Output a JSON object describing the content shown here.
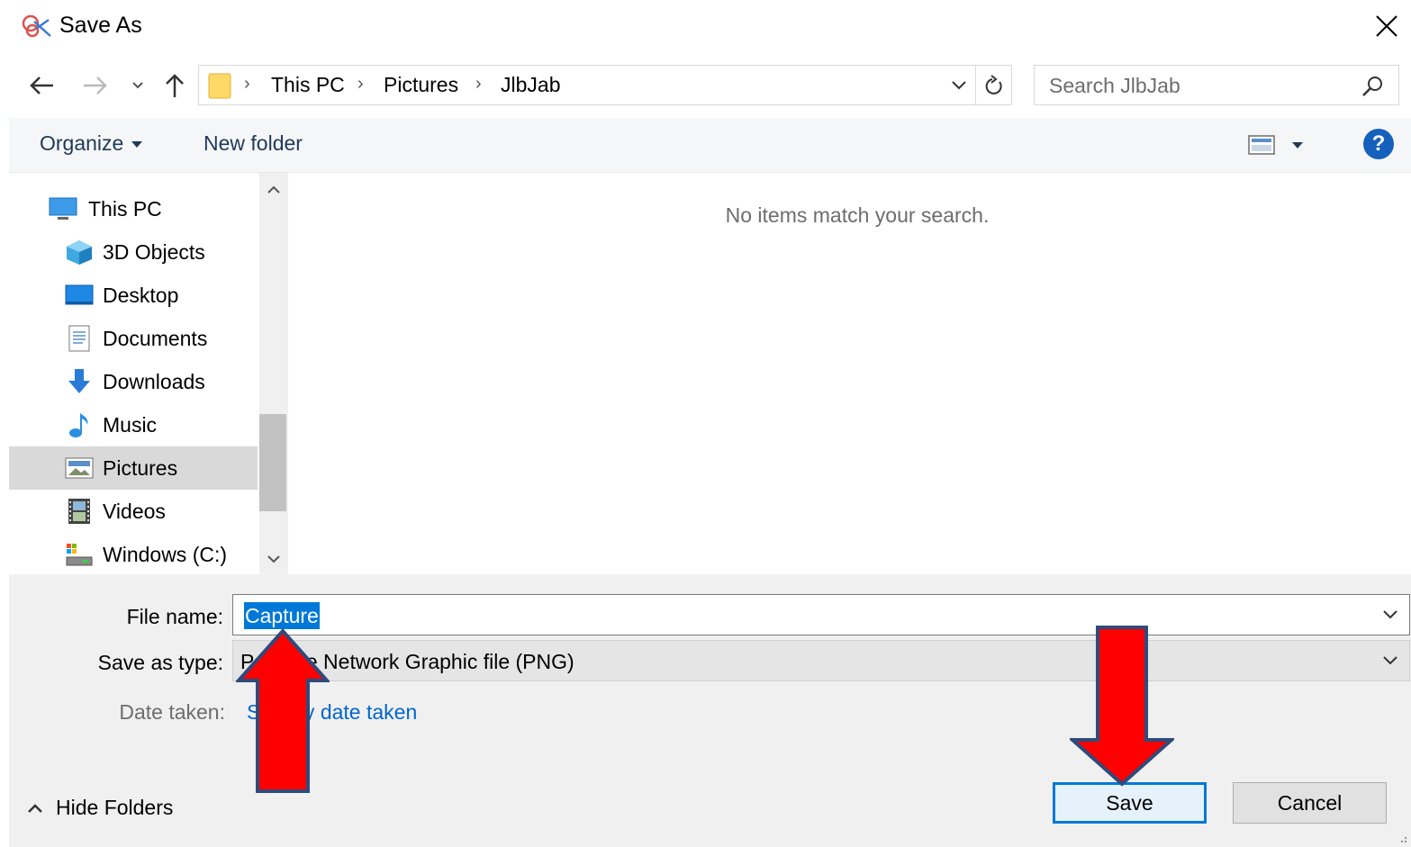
{
  "window": {
    "title": "Save As",
    "app_icon": "snipping-tool-icon",
    "close_icon": "close-icon"
  },
  "address": {
    "folder_icon": "folder-icon",
    "breadcrumbs": [
      "This PC",
      "Pictures",
      "JlbJab"
    ],
    "separator": "›"
  },
  "search": {
    "placeholder": "Search JlbJab"
  },
  "toolbar": {
    "organize_label": "Organize",
    "new_folder_label": "New folder",
    "help_label": "?"
  },
  "nav": {
    "items": [
      {
        "label": "This PC",
        "icon": "computer-icon"
      },
      {
        "label": "3D Objects",
        "icon": "cube-icon"
      },
      {
        "label": "Desktop",
        "icon": "desktop-icon"
      },
      {
        "label": "Documents",
        "icon": "document-icon"
      },
      {
        "label": "Downloads",
        "icon": "download-arrow-icon"
      },
      {
        "label": "Music",
        "icon": "music-note-icon"
      },
      {
        "label": "Pictures",
        "icon": "pictures-icon",
        "selected": true
      },
      {
        "label": "Videos",
        "icon": "film-icon"
      },
      {
        "label": "Windows (C:)",
        "icon": "drive-icon"
      }
    ]
  },
  "content": {
    "empty_message": "No items match your search."
  },
  "form": {
    "file_name_label": "File name:",
    "file_name_value": "Capture",
    "save_type_label": "Save as type:",
    "save_type_value": "Portable Network Graphic file (PNG)",
    "date_taken_label": "Date taken:",
    "date_taken_link": "Specify date taken"
  },
  "footer": {
    "hide_folders_label": "Hide Folders",
    "save_label": "Save",
    "cancel_label": "Cancel"
  },
  "colors": {
    "accent": "#0078d7",
    "selection": "#0078d7",
    "link": "#0066cc",
    "annotation_arrow": "#ff0000",
    "annotation_outline": "#2f4b7c"
  }
}
